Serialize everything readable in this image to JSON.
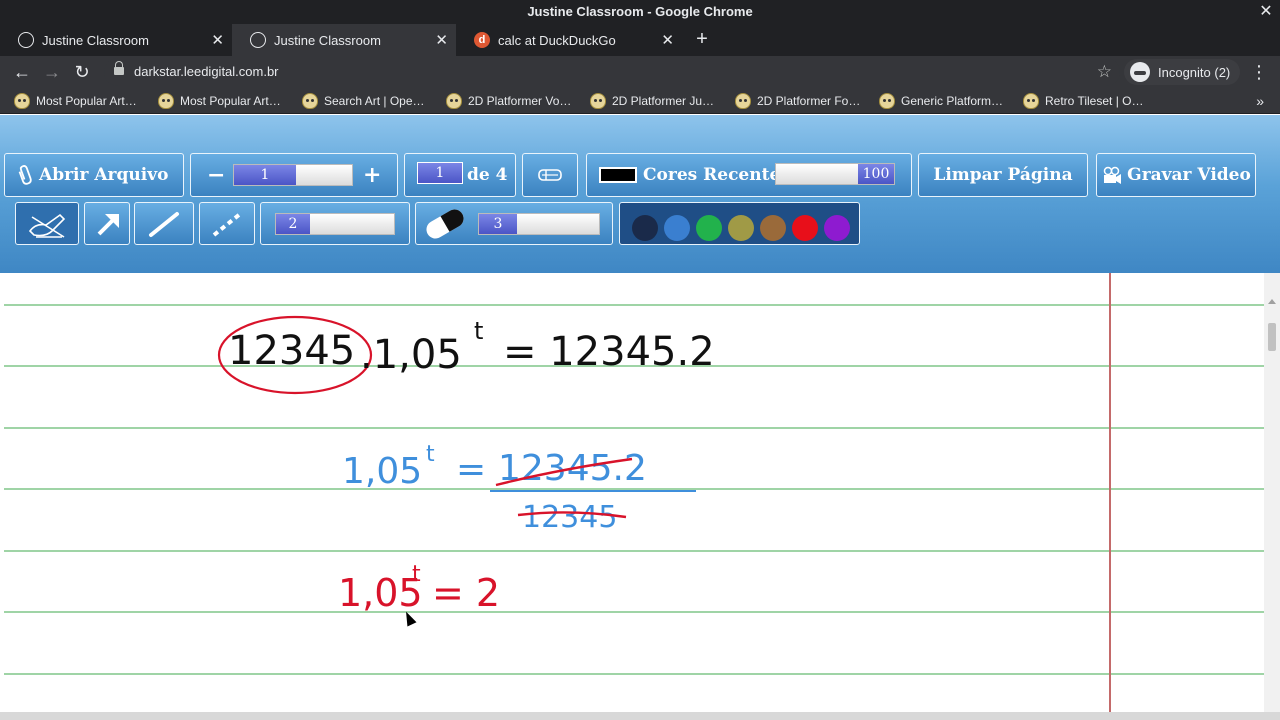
{
  "window": {
    "title": "Justine Classroom - Google Chrome",
    "close_glyph": "✕"
  },
  "tabs": [
    {
      "label": "Justine Classroom",
      "active": false
    },
    {
      "label": "Justine Classroom",
      "active": true
    },
    {
      "label": "calc at DuckDuckGo",
      "active": false
    }
  ],
  "toolbar": {
    "url": "darkstar.leedigital.com.br",
    "incognito_label": "Incognito (2)"
  },
  "bookmarks": [
    "Most Popular Art…",
    "Most Popular Art…",
    "Search Art | Ope…",
    "2D Platformer Vo…",
    "2D Platformer Ju…",
    "2D Platformer Fo…",
    "Generic Platform…",
    "Retro Tileset | O…"
  ],
  "app": {
    "open_file_label": "Abrir Arquivo",
    "zoom_minus": "−",
    "zoom_value": "1",
    "zoom_plus": "+",
    "page_current": "1",
    "page_of": "de 4",
    "recent_colors_label": "Cores Recentes",
    "opacity_value": "100",
    "clear_page_label": "Limpar Página",
    "record_video_label": "Gravar Video",
    "pen_size_value": "2",
    "eraser_size_value": "3",
    "palette": [
      "#1a2a4a",
      "#3a7fd0",
      "#22b24c",
      "#a09a46",
      "#9a6a3a",
      "#e80f1a",
      "#8e1bd0"
    ],
    "current_color": "#000000"
  },
  "canvas": {
    "line1": {
      "circled": "12345",
      "rest": ".1,05",
      "exp": "t",
      "rhs": "= 12345.2"
    },
    "line2": {
      "lhs": "1,05",
      "exp": "t",
      "eq": "=",
      "numer": "12345.2",
      "denom": "12345"
    },
    "line3": {
      "lhs": "1,05",
      "exp": "t",
      "rhs": "= 2"
    },
    "ink_black": "#111111",
    "ink_blue": "#3f8fdc",
    "ink_red": "#d8132a"
  }
}
